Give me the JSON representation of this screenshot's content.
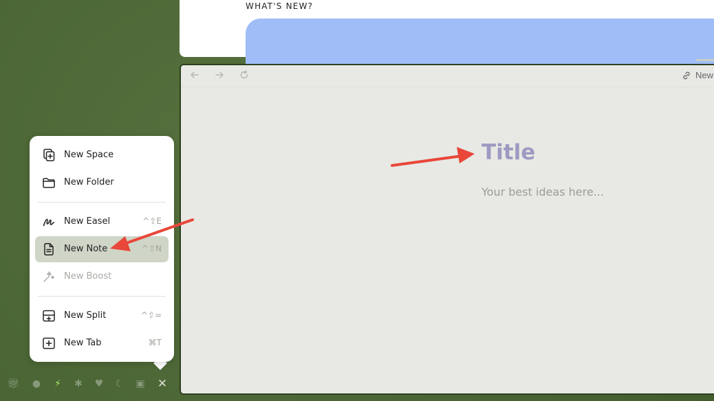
{
  "whats_new": {
    "label": "WHAT'S NEW?"
  },
  "toolbar": {
    "back_icon": "arrow-left-icon",
    "forward_icon": "arrow-right-icon",
    "reload_icon": "reload-icon",
    "link_label": "New"
  },
  "note": {
    "title_placeholder": "Title",
    "body_placeholder": "Your best ideas here..."
  },
  "menu": {
    "items": [
      {
        "label": "New Space",
        "shortcut": "",
        "icon": "new-space-icon"
      },
      {
        "label": "New Folder",
        "shortcut": "",
        "icon": "folder-icon"
      },
      {
        "label": "New Easel",
        "shortcut": "^⇧E",
        "icon": "easel-icon"
      },
      {
        "label": "New Note",
        "shortcut": "^⇧N",
        "icon": "note-icon",
        "state": "highlighted"
      },
      {
        "label": "New Boost",
        "shortcut": "",
        "icon": "boost-icon",
        "state": "disabled"
      },
      {
        "label": "New Split",
        "shortcut": "^⇧=",
        "icon": "split-icon"
      },
      {
        "label": "New Tab",
        "shortcut": "⌘T",
        "icon": "new-tab-icon"
      }
    ]
  },
  "bottom_bar": {
    "icons": [
      "gift-icon",
      "turtle-icon",
      "bolt-icon",
      "asterisk-icon",
      "heart-icon",
      "moon-icon",
      "present-icon",
      "close-icon"
    ],
    "active": "bolt-icon"
  },
  "colors": {
    "desktop": "#4f6a38",
    "accent_card": "#a0bdf8",
    "title_color": "#9d9ac2",
    "highlight": "#d0d6c7",
    "annotation_arrow": "#e8473a"
  }
}
